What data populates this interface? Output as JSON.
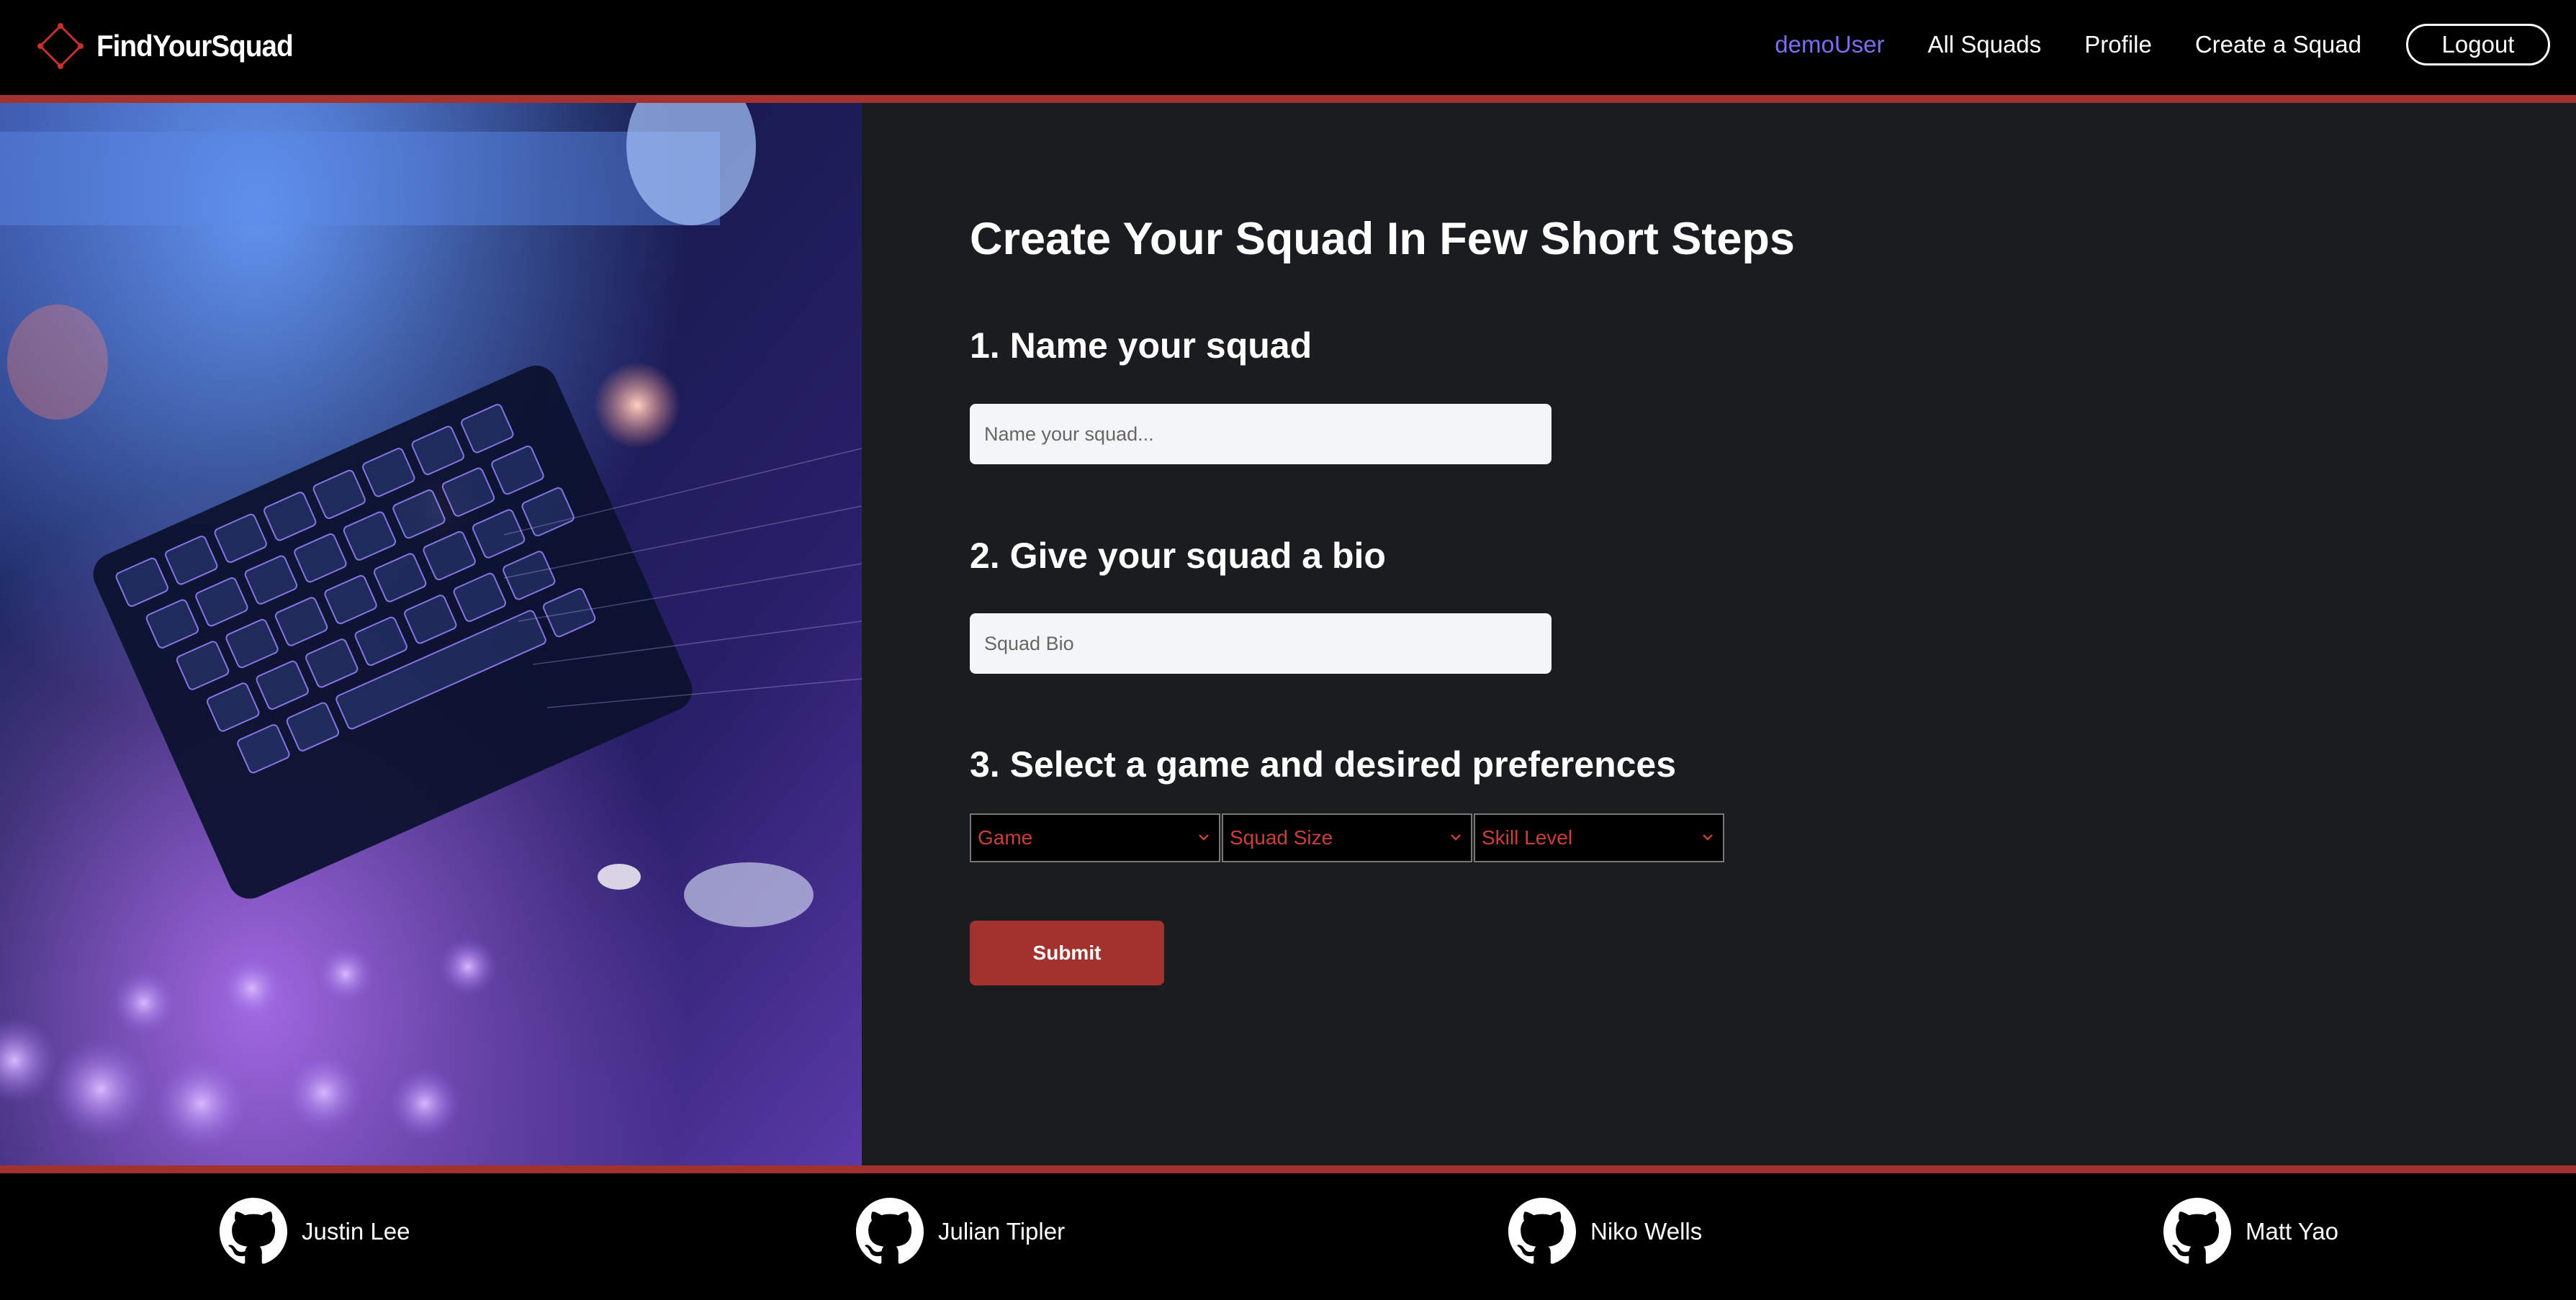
{
  "navbar": {
    "brand": "FindYourSquad",
    "user": "demoUser",
    "links": [
      "All Squads",
      "Profile",
      "Create a Squad"
    ],
    "logout": "Logout"
  },
  "form": {
    "title": "Create Your Squad In Few Short Steps",
    "step1": "1. Name your squad",
    "name_placeholder": "Name your squad...",
    "step2": "2. Give your squad a bio",
    "bio_placeholder": "Squad Bio",
    "step3": "3. Select a game and desired preferences",
    "selects": [
      "Game",
      "Squad Size",
      "Skill Level"
    ],
    "submit": "Submit"
  },
  "footer": {
    "members": [
      "Justin Lee",
      "Julian Tipler",
      "Niko Wells",
      "Matt Yao"
    ]
  },
  "colors": {
    "accent": "#a3312d",
    "user_link": "#7b6cf0",
    "select_text": "#c9403a",
    "panel_bg": "#1b1c1f"
  }
}
